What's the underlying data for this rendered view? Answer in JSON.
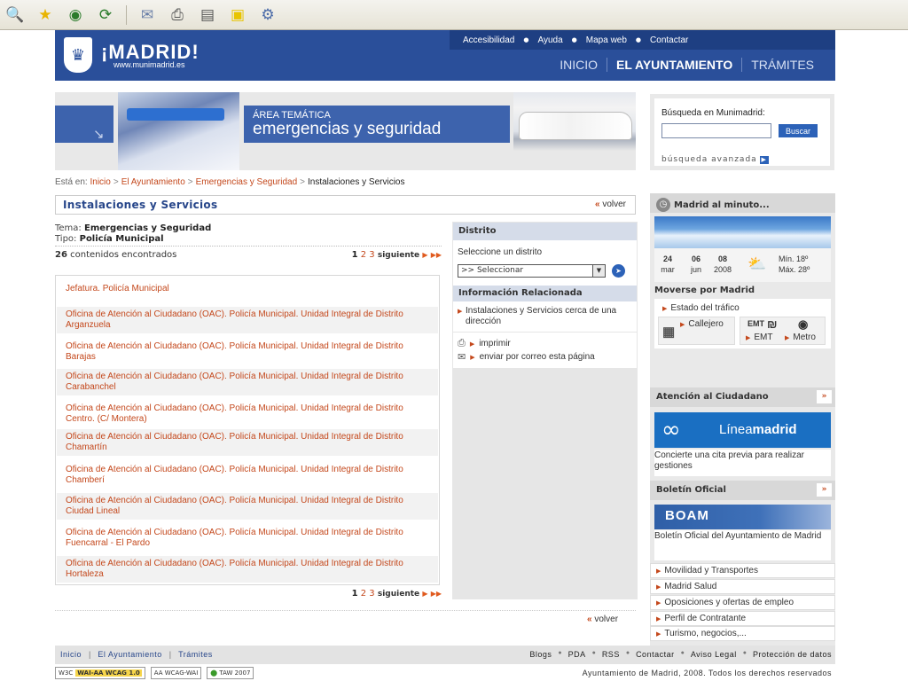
{
  "browser_toolbar": {
    "icons": [
      "search-icon",
      "favorites-star-icon",
      "media-icon",
      "history-icon",
      "mail-icon",
      "print-icon",
      "edit-icon",
      "note-icon",
      "messenger-icon"
    ]
  },
  "header": {
    "logo_text": "¡MADRID!",
    "logo_url": "www.munimadrid.es",
    "top_links": [
      "Accesibilidad",
      "Ayuda",
      "Mapa web",
      "Contactar"
    ],
    "nav": [
      "INICIO",
      "EL AYUNTAMIENTO",
      "TRÁMITES"
    ],
    "nav_active": "EL AYUNTAMIENTO"
  },
  "banner": {
    "area_label": "ÁREA TEMÁTICA",
    "area_title": "emergencias y seguridad"
  },
  "search": {
    "label": "Búsqueda en Munimadrid:",
    "input_value": "",
    "button": "Buscar",
    "advanced": "búsqueda avanzada"
  },
  "breadcrumb": {
    "prefix": "Está en:",
    "items": [
      "Inicio",
      "El Ayuntamiento",
      "Emergencias y Seguridad"
    ],
    "current": "Instalaciones y Servicios"
  },
  "content": {
    "title": "Instalaciones y Servicios",
    "volver": "volver",
    "tema_label": "Tema:",
    "tema_value": "Emergencias y Seguridad",
    "tipo_label": "Tipo:",
    "tipo_value": "Policía Municipal",
    "results_count": "26",
    "results_text": "contenidos encontrados",
    "pager": {
      "current": "1",
      "pages": [
        "2",
        "3"
      ],
      "next": "siguiente"
    },
    "items": [
      "Jefatura. Policía Municipal",
      "Oficina de Atención al Ciudadano (OAC). Policía Municipal. Unidad Integral de Distrito Arganzuela",
      "Oficina de Atención al Ciudadano (OAC). Policía Municipal. Unidad Integral de Distrito Barajas",
      "Oficina de Atención al Ciudadano (OAC). Policía Municipal. Unidad Integral de Distrito Carabanchel",
      "Oficina de Atención al Ciudadano (OAC). Policía Municipal. Unidad Integral de Distrito Centro. (C/ Montera)",
      "Oficina de Atención al Ciudadano (OAC). Policía Municipal. Unidad Integral de Distrito Chamartín",
      "Oficina de Atención al Ciudadano (OAC). Policía Municipal. Unidad Integral de Distrito Chamberí",
      "Oficina de Atención al Ciudadano (OAC). Policía Municipal. Unidad Integral de Distrito Ciudad Lineal",
      "Oficina de Atención al Ciudadano (OAC). Policía Municipal. Unidad Integral de Distrito Fuencarral - El Pardo",
      "Oficina de Atención al Ciudadano (OAC). Policía Municipal. Unidad Integral de Distrito Hortaleza"
    ]
  },
  "district": {
    "heading": "Distrito",
    "label": "Seleccione un distrito",
    "select_value": ">> Seleccionar",
    "info_heading": "Información Relacionada",
    "info_link": "Instalaciones y Servicios cerca de una dirección",
    "print": "imprimir",
    "email": "enviar por correo esta página"
  },
  "sidebar": {
    "minute_title": "Madrid al minuto...",
    "dates": [
      {
        "day": "24",
        "month": "mar"
      },
      {
        "day": "06",
        "month": "jun"
      },
      {
        "day": "08",
        "month": "2008"
      }
    ],
    "temp_min": "Mín. 18º",
    "temp_max": "Máx. 28º",
    "mover_title": "Moverse por Madrid",
    "trafico": "Estado del tráfico",
    "callejero": "Callejero",
    "emt": "EMT",
    "metro": "Metro",
    "emt_logo": "EMT",
    "atencion_title": "Atención al Ciudadano",
    "linea_madrid_a": "Línea",
    "linea_madrid_b": "madrid",
    "atencion_desc": "Concierte una cita previa para realizar gestiones",
    "boletin_title": "Boletín Oficial",
    "boam": "BOAM",
    "boletin_desc": "Boletín Oficial del Ayuntamiento de Madrid",
    "links": [
      "Movilidad y Transportes",
      "Madrid Salud",
      "Oposiciones y ofertas de empleo",
      "Perfil de Contratante",
      "Turismo, negocios,..."
    ],
    "more": "»"
  },
  "footer": {
    "left": [
      "Inicio",
      "El Ayuntamiento",
      "Trámites"
    ],
    "right": [
      "Blogs",
      "PDA",
      "RSS",
      "Contactar",
      "Aviso Legal",
      "Protección de datos"
    ],
    "copyright": "Ayuntamiento de Madrid, 2008. Todos los derechos reservados",
    "badges": [
      "W3C",
      "WAI-AA WCAG 1.0",
      "AA WCAG-WAI",
      "TAW 2007"
    ]
  },
  "colors": {
    "header_blue": "#2a4f9a",
    "link_orange": "#c4481c",
    "title_blue": "#27468a"
  }
}
